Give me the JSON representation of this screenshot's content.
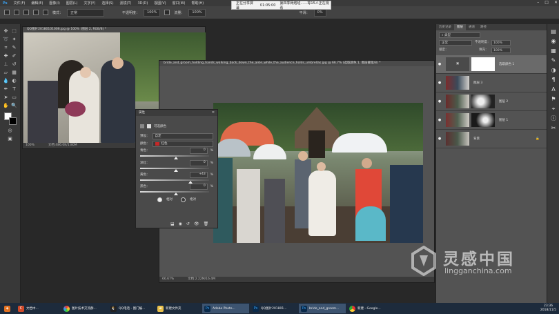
{
  "menu": [
    "文件(F)",
    "编辑(E)",
    "图像(I)",
    "图层(L)",
    "文字(Y)",
    "选择(S)",
    "滤镜(T)",
    "3D(D)",
    "视图(V)",
    "窗口(W)",
    "帮助(H)"
  ],
  "options": {
    "mode_label": "模式：",
    "mode_value": "正常",
    "opacity_label": "不透明度：",
    "opacity_value": "100%",
    "flow_label": "流量：",
    "flow_value": "100%",
    "smooth_label": "平滑：",
    "smooth_value": "0%"
  },
  "share": {
    "status": "正在分享屏幕",
    "time": "01:05:00",
    "viewers": "第四季网络班……等15人正在观看"
  },
  "doc1": {
    "title": "QQ图片20180101006.jpg @ 100% (图层 2, RGB/8) *",
    "zoom": "100%",
    "info": "文档:486.0K/1.80M"
  },
  "doc2": {
    "title": "bride_and_groom_holding_hands_walking_back_down_the_aisle_while_the_audience_holds_umbrellas.jpg @ 66.7% (选取颜色 1, 图层蒙版/8) *",
    "zoom": "66.67%",
    "info": "文档:2.22M/16.4M"
  },
  "properties": {
    "tab": "属性",
    "panel_title": "可选颜色",
    "preset_label": "预设：",
    "preset_value": "自定",
    "color_label": "颜色：",
    "color_value": "红色",
    "rows": [
      {
        "label": "青色：",
        "value": "0",
        "unit": "%"
      },
      {
        "label": "洋红：",
        "value": "0",
        "unit": "%"
      },
      {
        "label": "黄色：",
        "value": "+43",
        "unit": "%"
      },
      {
        "label": "黑色：",
        "value": "0",
        "unit": "%"
      }
    ],
    "relative": "相对",
    "absolute": "绝对"
  },
  "layers": {
    "tabs": [
      "历史记录",
      "图层",
      "通道",
      "路径"
    ],
    "filter": "类型",
    "blend": "正常",
    "opacity_label": "不透明度：",
    "opacity": "100%",
    "lock_label": "锁定：",
    "fill_label": "填充：",
    "fill": "100%",
    "items": [
      {
        "name": "选取颜色 1"
      },
      {
        "name": "图层 3"
      },
      {
        "name": "图层 2"
      },
      {
        "name": "图层 1"
      },
      {
        "name": "背景"
      }
    ]
  },
  "taskbar": {
    "items": [
      "文档中...",
      "图片技术交流群...",
      "QQ电话 - 图门编...",
      "新建文件夹",
      "Adobe Photo...",
      "QQ图片201801...",
      "bride_and_groom...",
      "新建 - Google..."
    ],
    "time": "23:36",
    "date": "2018/11/5"
  },
  "watermark": {
    "cn": "灵感中国",
    "en": "lingganchina.com"
  },
  "colors": {
    "accent": "#2e8bd8",
    "red_swatch": "#c62828"
  }
}
